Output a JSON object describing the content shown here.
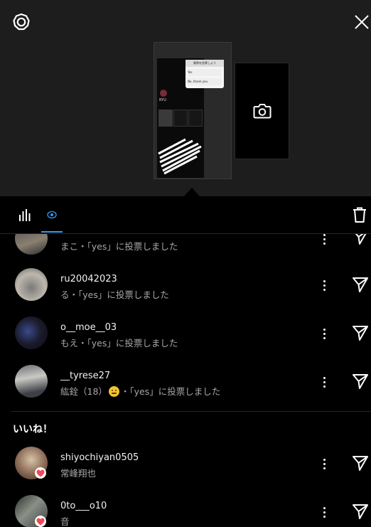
{
  "header": {
    "settings_icon": "gear-icon",
    "close_icon": "close-icon"
  },
  "story_preview": {
    "overlay_title": "質問を投票しよう",
    "option_1": "Yes",
    "option_2": "No, thank you",
    "profile_name": "RYU"
  },
  "tabs": {
    "insights_icon": "bar-chart-icon",
    "viewers_icon": "eye-icon",
    "delete_icon": "trash-icon"
  },
  "viewers": [
    {
      "username": "",
      "subtitle": "まこ・「yes」に投票しました"
    },
    {
      "username": "ru20042023",
      "subtitle": "る・「yes」に投票しました"
    },
    {
      "username": "o__moe__03",
      "subtitle": "もえ・「yes」に投票しました"
    },
    {
      "username": "__tyrese27",
      "subtitle_pre": "紘銓（18）",
      "subtitle_post": "・「yes」に投票しました"
    }
  ],
  "likes_section": {
    "title": "いいね！",
    "items": [
      {
        "username": "shiyochiyan0505",
        "subtitle": "常峰翔也"
      },
      {
        "username": "0to___o10",
        "subtitle": "音"
      }
    ]
  },
  "colors": {
    "background": "#000000",
    "top_area": "#1d1d1d",
    "heart": "#ed4956",
    "active_eye": "#3897f0"
  }
}
